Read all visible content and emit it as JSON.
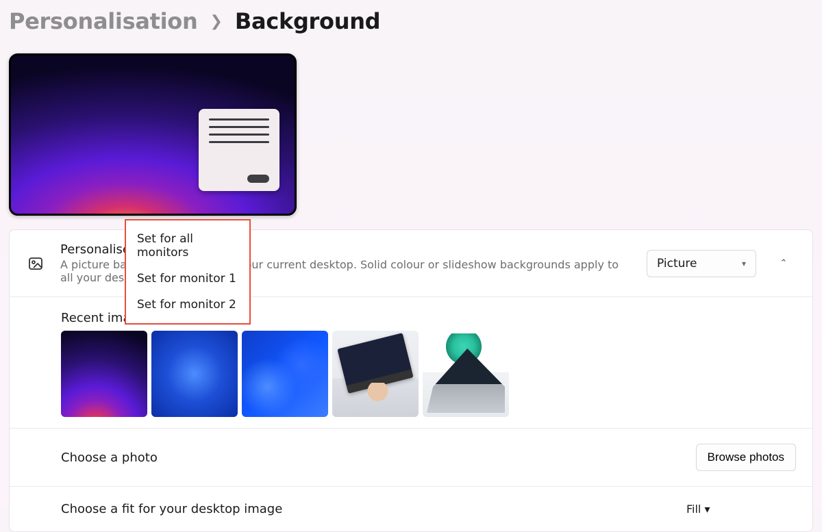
{
  "breadcrumb": {
    "parent": "Personalisation",
    "current": "Background"
  },
  "personalise_row": {
    "title": "Personalise your background",
    "subtitle": "A picture background applies to your current desktop. Solid colour or slideshow backgrounds apply to all your desktops.",
    "select_value": "Picture"
  },
  "context_menu": {
    "items": [
      "Set for all monitors",
      "Set for monitor 1",
      "Set for monitor 2"
    ]
  },
  "recent_images": {
    "heading": "Recent images"
  },
  "choose_photo": {
    "label": "Choose a photo",
    "button": "Browse photos"
  },
  "choose_fit": {
    "label": "Choose a fit for your desktop image",
    "select_value": "Fill"
  }
}
